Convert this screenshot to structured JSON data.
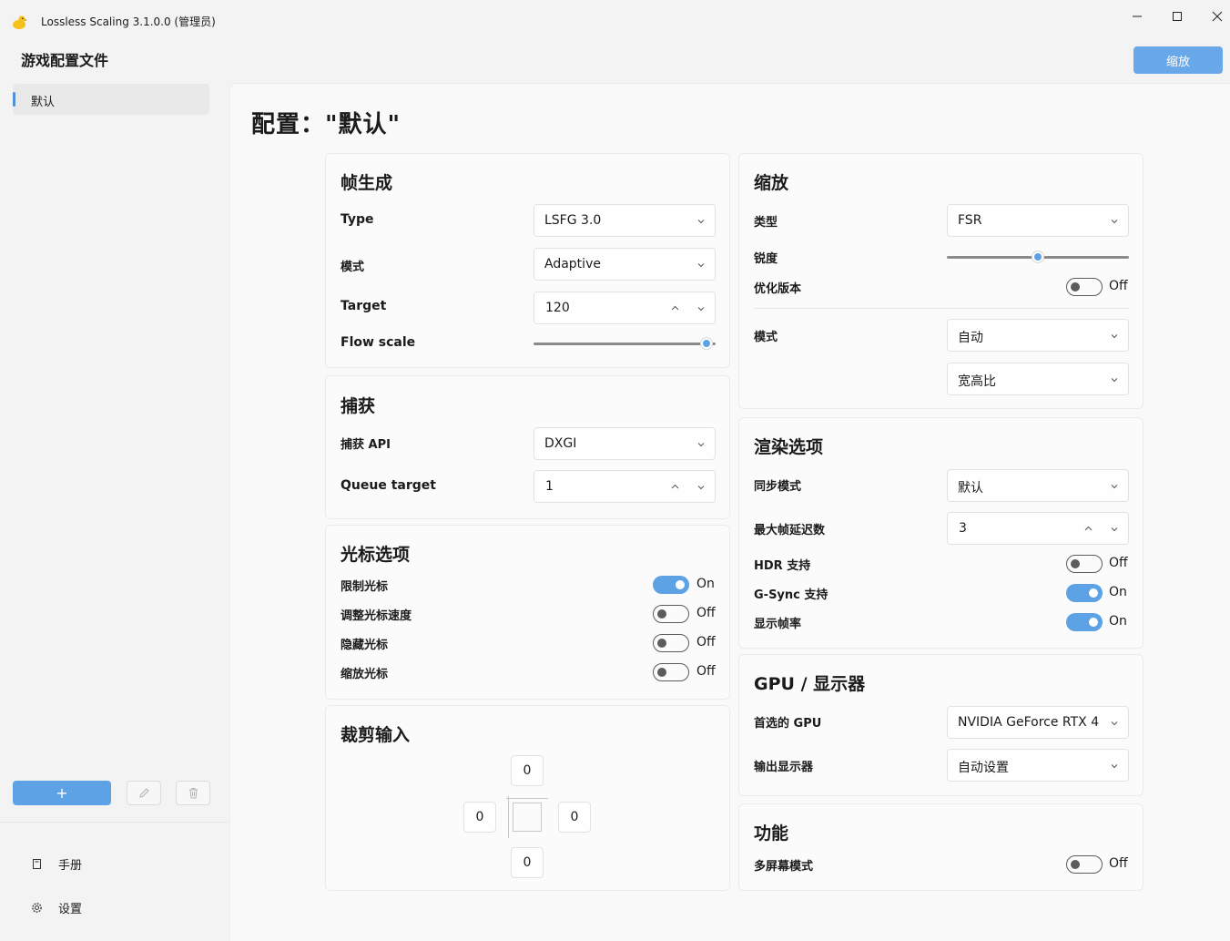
{
  "window": {
    "title": "Lossless Scaling 3.1.0.0 (管理员)"
  },
  "sidebar": {
    "title": "游戏配置文件",
    "profiles": [
      {
        "label": "默认"
      }
    ],
    "add_label": "+",
    "nav": [
      {
        "label": "手册",
        "icon": "book-icon"
      },
      {
        "label": "设置",
        "icon": "gear-icon"
      }
    ]
  },
  "toolbar": {
    "scale_button": "缩放"
  },
  "page": {
    "title": "配置：\"默认\""
  },
  "frame_gen": {
    "title": "帧生成",
    "type_label": "Type",
    "type_value": "LSFG 3.0",
    "mode_label": "模式",
    "mode_value": "Adaptive",
    "target_label": "Target",
    "target_value": "120",
    "flow_label": "Flow scale",
    "flow_level": 0.95
  },
  "capture": {
    "title": "捕获",
    "api_label": "捕获 API",
    "api_value": "DXGI",
    "queue_label": "Queue target",
    "queue_value": "1"
  },
  "cursor": {
    "title": "光标选项",
    "options": [
      {
        "label": "限制光标",
        "state": "On",
        "on": true
      },
      {
        "label": "调整光标速度",
        "state": "Off",
        "on": false
      },
      {
        "label": "隐藏光标",
        "state": "Off",
        "on": false
      },
      {
        "label": "缩放光标",
        "state": "Off",
        "on": false
      }
    ]
  },
  "crop": {
    "title": "裁剪输入",
    "top": "0",
    "left": "0",
    "right": "0",
    "bottom": "0"
  },
  "scaling": {
    "title": "缩放",
    "type_label": "类型",
    "type_value": "FSR",
    "sharpness_label": "锐度",
    "sharpness_level": 0.5,
    "optimized_label": "优化版本",
    "optimized_state": "Off",
    "mode_label": "模式",
    "mode_value": "自动",
    "aspect_value": "宽高比"
  },
  "render": {
    "title": "渲染选项",
    "sync_label": "同步模式",
    "sync_value": "默认",
    "latency_label": "最大帧延迟数",
    "latency_value": "3",
    "toggles": [
      {
        "label": "HDR 支持",
        "state": "Off",
        "on": false
      },
      {
        "label": "G-Sync 支持",
        "state": "On",
        "on": true
      },
      {
        "label": "显示帧率",
        "state": "On",
        "on": true
      }
    ]
  },
  "gpu": {
    "title": "GPU / 显示器",
    "gpu_label": "首选的 GPU",
    "gpu_value": "NVIDIA GeForce RTX 4",
    "display_label": "输出显示器",
    "display_value": "自动设置"
  },
  "features": {
    "title": "功能",
    "multi_label": "多屏幕模式",
    "multi_state": "Off"
  },
  "colors": {
    "accent": "#5ea2e6",
    "page_bg": "#f3f3f3"
  }
}
